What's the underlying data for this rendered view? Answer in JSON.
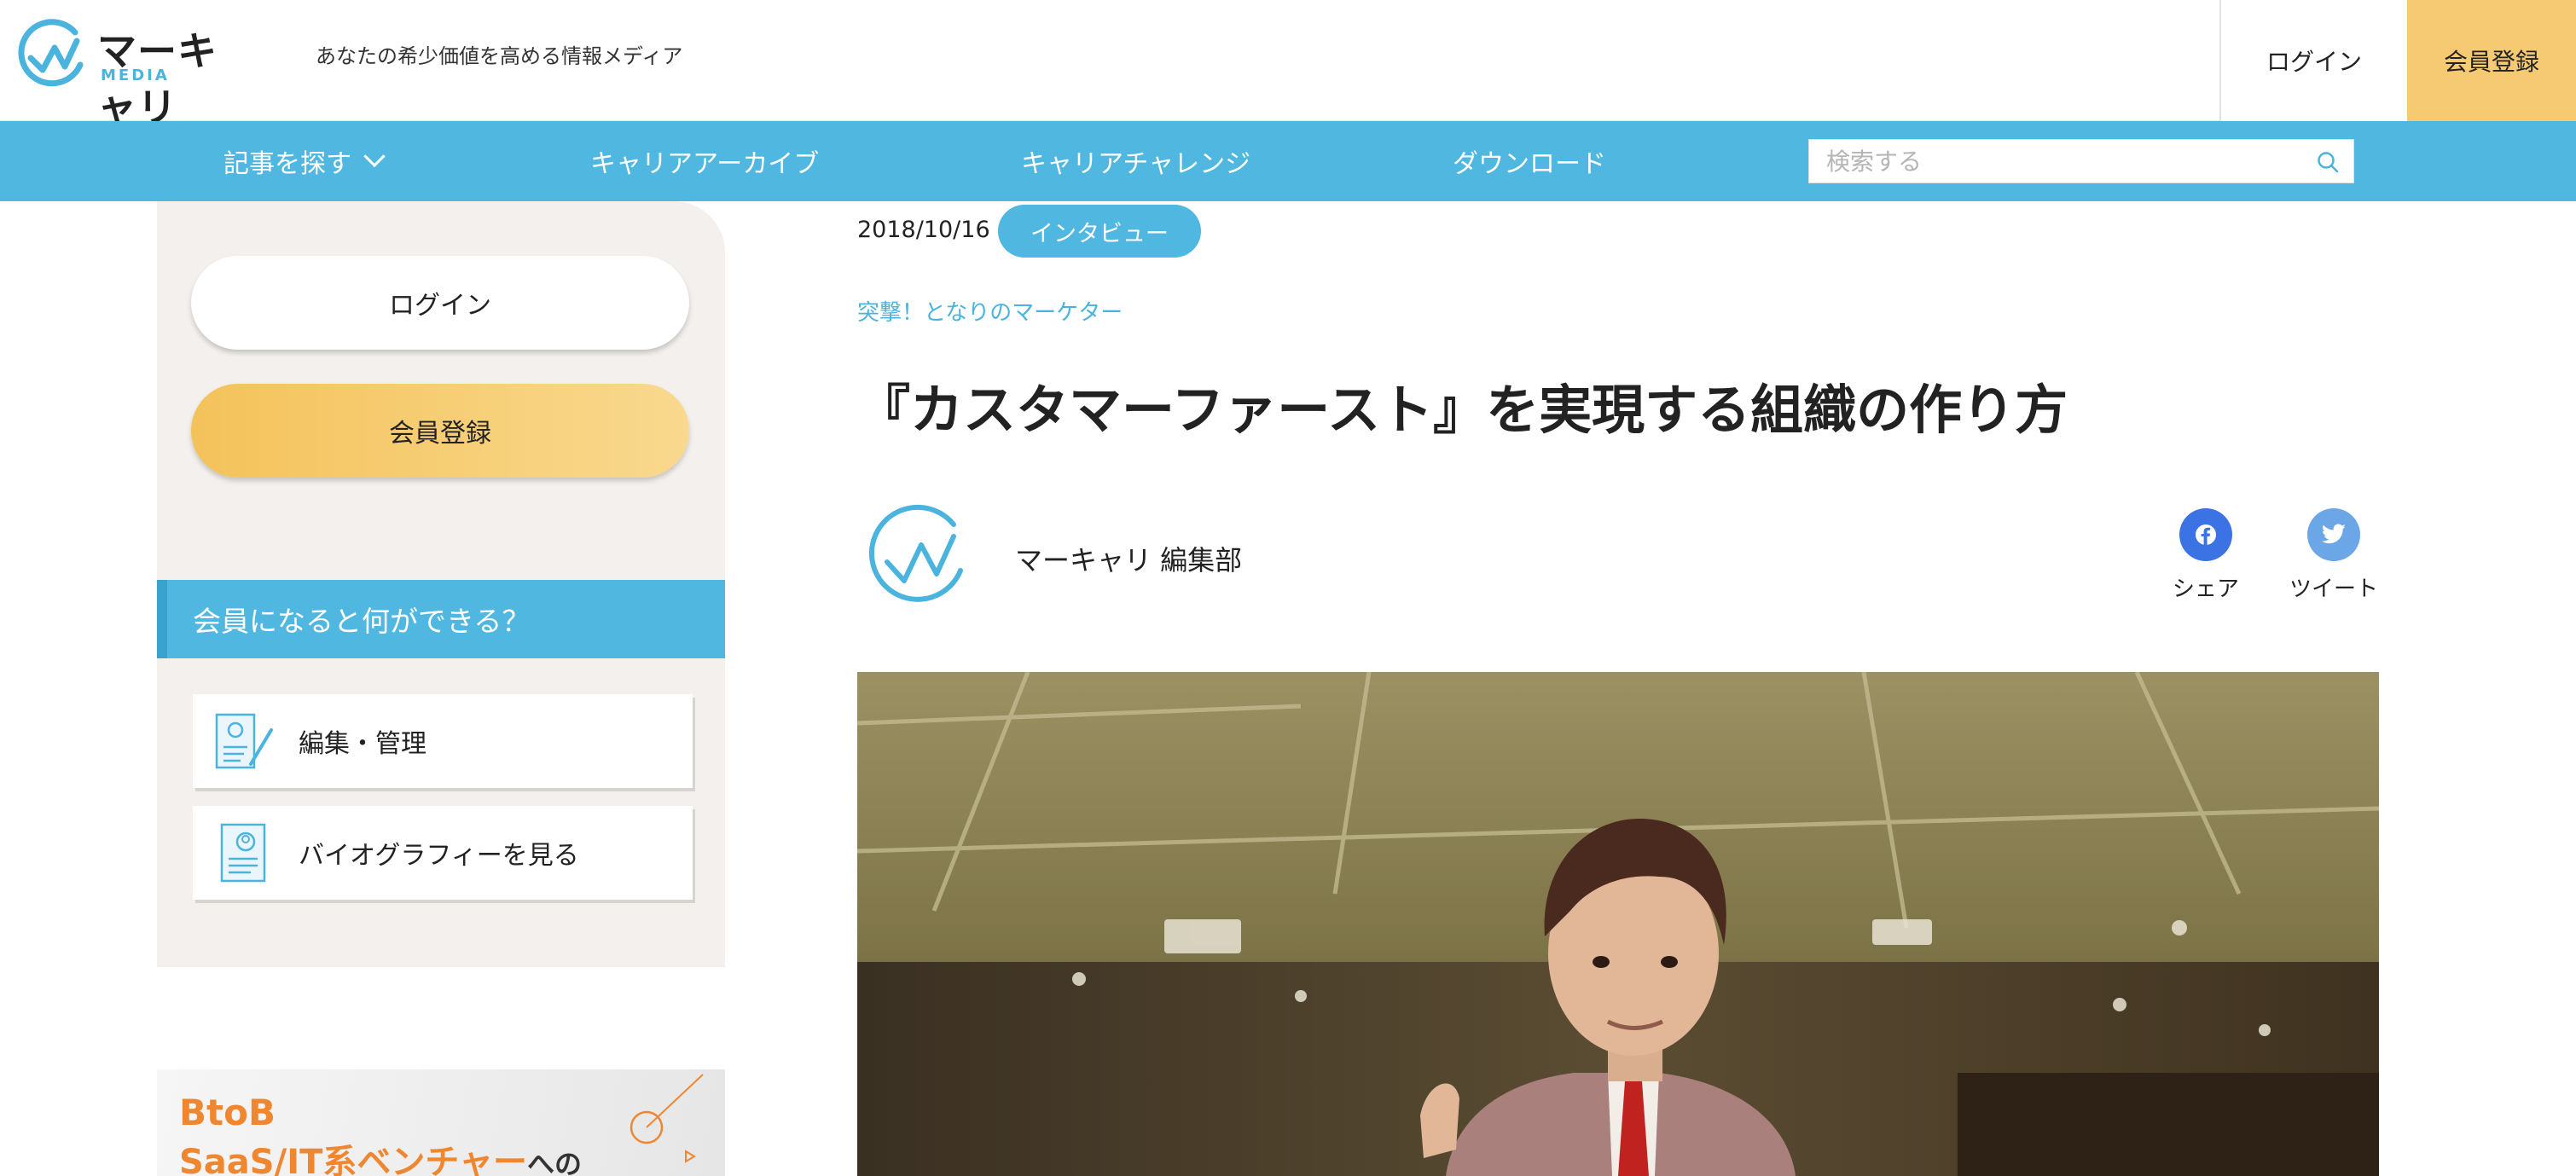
{
  "header": {
    "logo_text": "マーキャリ",
    "logo_sub": "MEDIA",
    "tagline": "あなたの希少価値を高める情報メディア",
    "login_label": "ログイン",
    "register_label": "会員登録"
  },
  "nav": {
    "items": [
      {
        "label": "記事を探す"
      },
      {
        "label": "キャリアアーカイブ"
      },
      {
        "label": "キャリアチャレンジ"
      },
      {
        "label": "ダウンロード"
      }
    ],
    "search_placeholder": "検索する"
  },
  "sidebar": {
    "login_label": "ログイン",
    "register_label": "会員登録",
    "band_title": "会員になると何ができる？",
    "cards": [
      {
        "label": "編集・管理",
        "icon": "edit-document-icon"
      },
      {
        "label": "バイオグラフィーを見る",
        "icon": "biography-icon"
      }
    ],
    "banner": {
      "line1": "BtoB",
      "line2": "SaaS/IT系ベンチャー",
      "line2_suffix": "への"
    }
  },
  "article": {
    "date": "2018/10/16",
    "tag": "インタビュー",
    "series": "突撃！となりのマーケター",
    "title": "『カスタマーファースト』を実現する組織の作り方",
    "author": "マーキャリ 編集部",
    "share": [
      {
        "label": "シェア",
        "icon": "facebook-icon",
        "color": "#3b72e4"
      },
      {
        "label": "ツイート",
        "icon": "twitter-icon",
        "color": "#6ba6e6"
      }
    ]
  },
  "colors": {
    "accent": "#50b8e0",
    "register": "#f6ca73",
    "sidebar_bg": "#f3f0ed"
  }
}
